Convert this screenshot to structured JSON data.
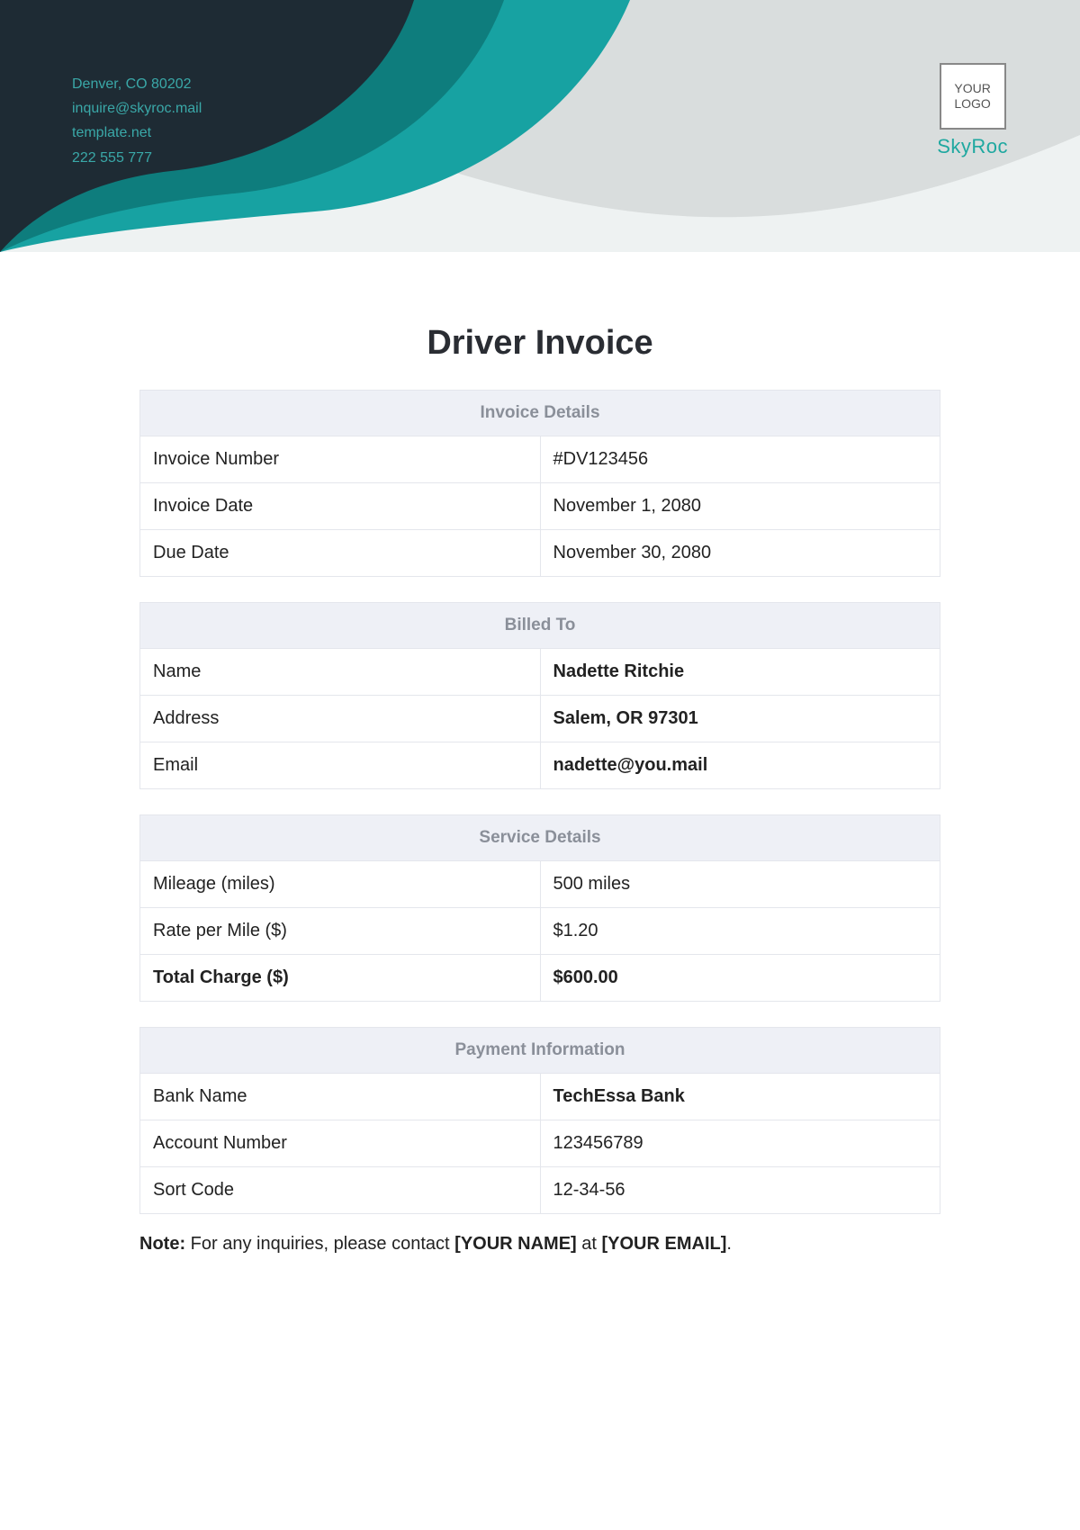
{
  "header": {
    "contact": {
      "address": "Denver, CO 80202",
      "email": "inquire@skyroc.mail",
      "website": "template.net",
      "phone": "222 555 777"
    },
    "logo_placeholder": "YOUR LOGO",
    "company_name": "SkyRoc"
  },
  "title": "Driver Invoice",
  "invoice_details": {
    "section_title": "Invoice Details",
    "rows": [
      {
        "label": "Invoice Number",
        "value": "#DV123456"
      },
      {
        "label": "Invoice Date",
        "value": "November 1, 2080"
      },
      {
        "label": "Due Date",
        "value": "November 30, 2080"
      }
    ]
  },
  "billed_to": {
    "section_title": "Billed To",
    "rows": [
      {
        "label": "Name",
        "value": "Nadette Ritchie"
      },
      {
        "label": "Address",
        "value": "Salem, OR 97301"
      },
      {
        "label": "Email",
        "value": "nadette@you.mail"
      }
    ]
  },
  "service_details": {
    "section_title": "Service Details",
    "rows": [
      {
        "label": "Mileage (miles)",
        "value": "500 miles",
        "bold_label": false
      },
      {
        "label": "Rate per Mile ($)",
        "value": "$1.20",
        "bold_label": false
      },
      {
        "label": "Total Charge ($)",
        "value": "$600.00",
        "bold_label": true
      }
    ]
  },
  "payment_info": {
    "section_title": "Payment Information",
    "rows": [
      {
        "label": "Bank Name",
        "value": "TechEssa Bank",
        "bold_value": true
      },
      {
        "label": "Account Number",
        "value": "123456789",
        "bold_value": false
      },
      {
        "label": "Sort Code",
        "value": "12-34-56",
        "bold_value": false
      }
    ]
  },
  "note": {
    "prefix": "Note:",
    "text_before": " For any inquiries, please contact ",
    "name_placeholder": "[YOUR NAME]",
    "text_middle": " at ",
    "email_placeholder": "[YOUR EMAIL]",
    "text_after": "."
  }
}
